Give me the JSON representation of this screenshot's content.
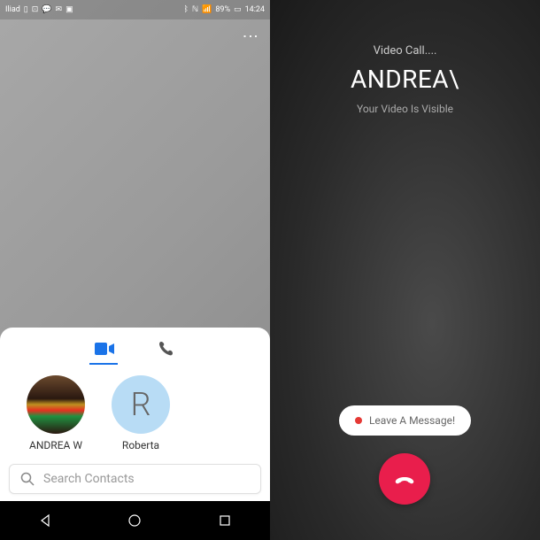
{
  "status_bar": {
    "carrier": "Iliad",
    "battery": "89%",
    "time": "14:24"
  },
  "tabs": {
    "video_active": true
  },
  "contacts": [
    {
      "name": "ANDREA W",
      "type": "photo"
    },
    {
      "name": "Roberta",
      "type": "letter",
      "letter": "R"
    }
  ],
  "search": {
    "placeholder": "Search Contacts"
  },
  "call": {
    "status": "Video Call....",
    "caller": "ANDREA\\",
    "video_status": "Your Video Is Visible",
    "leave_message": "Leave A Message!"
  },
  "colors": {
    "accent": "#1a73e8",
    "end_call": "#e91e4c",
    "record": "#e53935"
  }
}
